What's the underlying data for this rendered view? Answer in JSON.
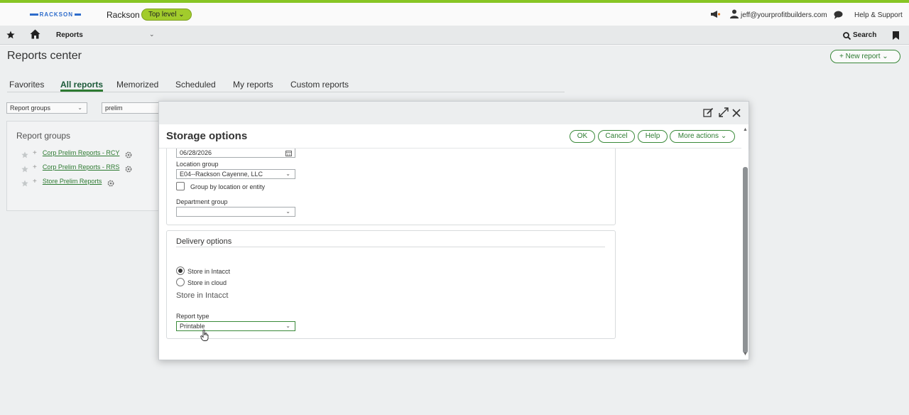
{
  "topbar": {
    "logo_text": "RACKSON",
    "company": "Rackson",
    "level_pill": "Top level ⌄",
    "user_email": "jeff@yourprofitbuilders.com",
    "help_support": "Help & Support",
    "colors": {
      "accent_line": "#8ac926",
      "pill": "#a6d12d",
      "brand_green": "#2e7d32"
    }
  },
  "navbar": {
    "module": "Reports",
    "chevron": "⌄",
    "search": "Search",
    "icons": [
      "star-icon",
      "home-icon",
      "search-icon",
      "bookmark-icon"
    ]
  },
  "page": {
    "title": "Reports center",
    "new_report": "+ New report  ⌄",
    "tabs": [
      "Favorites",
      "All reports",
      "Memorized",
      "Scheduled",
      "My reports",
      "Custom reports"
    ],
    "active_tab": "All reports",
    "group_select": "Report groups",
    "filter_value": "prelim",
    "groups_title": "Report groups",
    "groups": [
      "Corp Prelim Reports - RCY",
      "Corp Prelim Reports - RRS",
      "Store Prelim Reports"
    ]
  },
  "modal": {
    "title": "Storage options",
    "buttons": {
      "ok": "OK",
      "cancel": "Cancel",
      "help": "Help",
      "more": "More actions  ⌄"
    },
    "date_value": "06/28/2026",
    "location_group_label": "Location group",
    "location_group_value": "E04--Rackson Cayenne, LLC",
    "group_by_label": "Group by location or entity",
    "group_by_checked": false,
    "department_group_label": "Department group",
    "department_group_value": "",
    "delivery_title": "Delivery options",
    "delivery_options": [
      "Store in Intacct",
      "Store in cloud"
    ],
    "delivery_selected": "Store in Intacct",
    "store_subtitle": "Store in Intacct",
    "report_type_label": "Report type",
    "report_type_value": "Printable"
  }
}
